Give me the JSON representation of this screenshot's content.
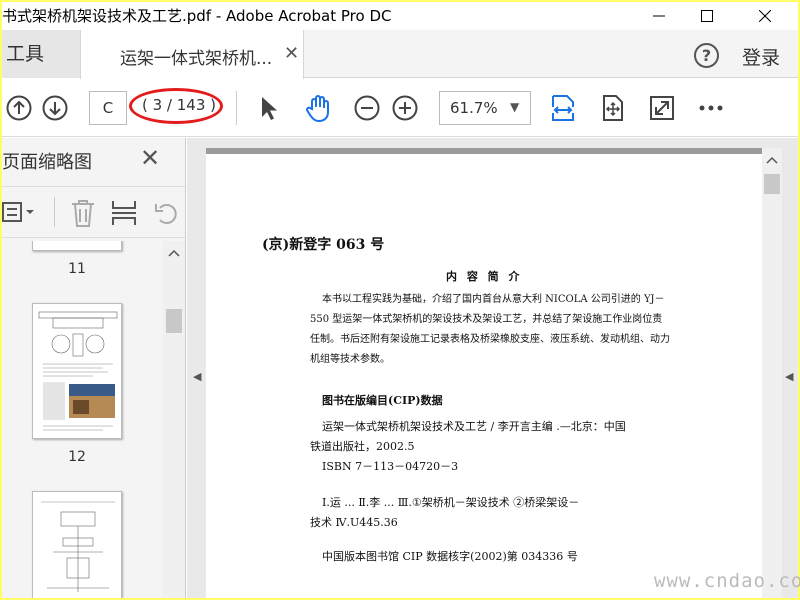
{
  "window": {
    "title": "书式架桥机架设技术及工艺.pdf - Adobe Acrobat Pro DC"
  },
  "tabs": {
    "tools": "工具",
    "document": "运架一体式架桥机...",
    "help": "?",
    "login": "登录"
  },
  "toolbar": {
    "page_input": "C",
    "page_count": "( 3 / 143 )",
    "zoom": "61.7%"
  },
  "left_pane": {
    "title": "页面缩略图",
    "thumbnails": [
      {
        "page": "11"
      },
      {
        "page": "12"
      }
    ]
  },
  "document": {
    "registration": "(京)新登字 063 号",
    "summary_title": "内 容 简 介",
    "summary_lines": [
      "本书以工程实践为基础，介绍了国内首台从意大利 NICOLA 公司引进的 YJ－",
      "550 型运架一体式架桥机的架设技术及架设工艺，并总结了架设施工作业岗位责",
      "任制。书后还附有架设施工记录表格及桥梁橡胶支座、液压系统、发动机组、动力",
      "机组等技术参数。"
    ],
    "cip_title": "图书在版编目(CIP)数据",
    "cip_lines": [
      "运架一体式架桥机架设技术及工艺 / 李开言主编 .—北京：中国",
      "铁道出版社，2002.5",
      "ISBN 7－113－04720－3"
    ],
    "class_lines": [
      "Ⅰ.运 ...    Ⅱ.李 ...    Ⅲ.①架桥机－架设技术   ②桥梁架设－",
      "技术   Ⅳ.U445.36"
    ],
    "cip_no": "中国版本图书馆 CIP 数据核字(2002)第 034336 号"
  },
  "watermark": "www.cndao.com",
  "colors": {
    "accent_blue": "#1a73e8",
    "annotation_red": "#e21b1b",
    "highlight_border": "#ffff66"
  }
}
